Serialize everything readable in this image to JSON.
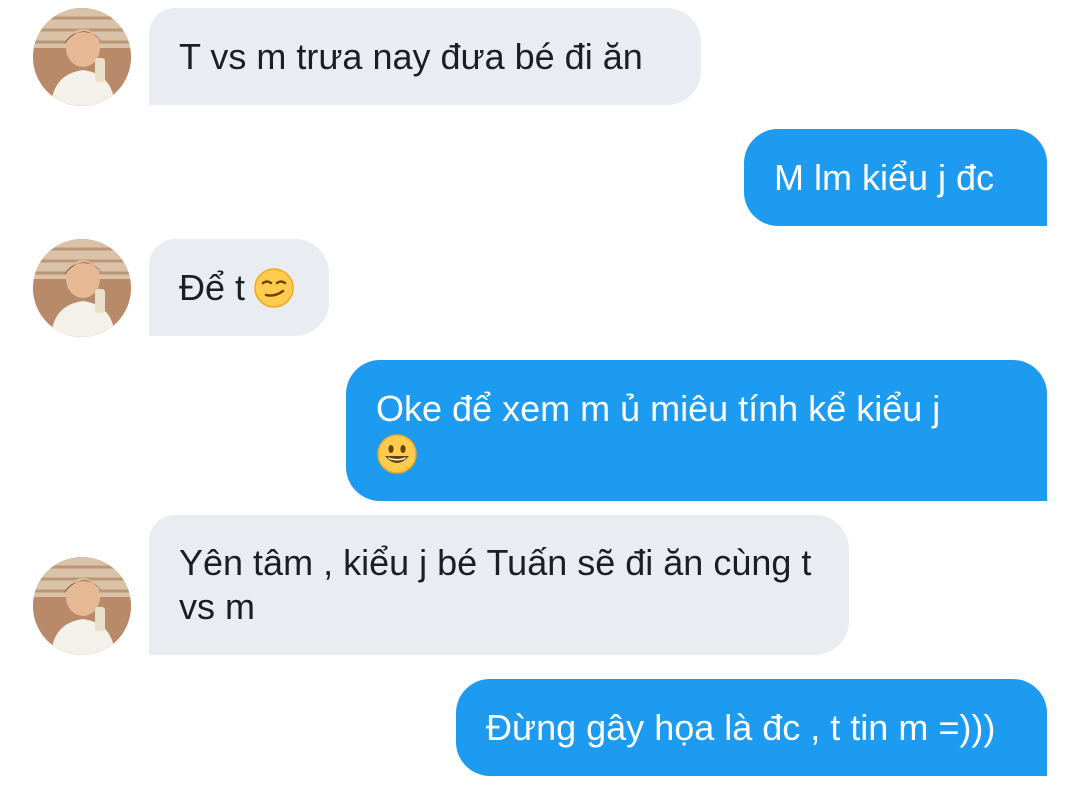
{
  "conversation": {
    "messages": [
      {
        "sender": "them",
        "text": "T vs m trưa nay đưa bé đi ăn"
      },
      {
        "sender": "me",
        "text": "M lm kiểu j đc"
      },
      {
        "sender": "them",
        "text": "Để t",
        "emoji": "smirking-face-emoji"
      },
      {
        "sender": "me",
        "text": "Oke để xem m ủ miêu tính kể kiểu j",
        "emoji": "grinning-face-emoji"
      },
      {
        "sender": "them",
        "text": "Yên tâm , kiểu j bé Tuấn sẽ đi ăn cùng t vs m"
      },
      {
        "sender": "me",
        "text": "Đừng gây họa là đc , t tin m =)))"
      }
    ]
  },
  "colors": {
    "incoming_bubble": "#e9edf1",
    "outgoing_bubble": "#1d9bf0",
    "incoming_text": "#1c1e21",
    "outgoing_text": "#ffffff"
  }
}
